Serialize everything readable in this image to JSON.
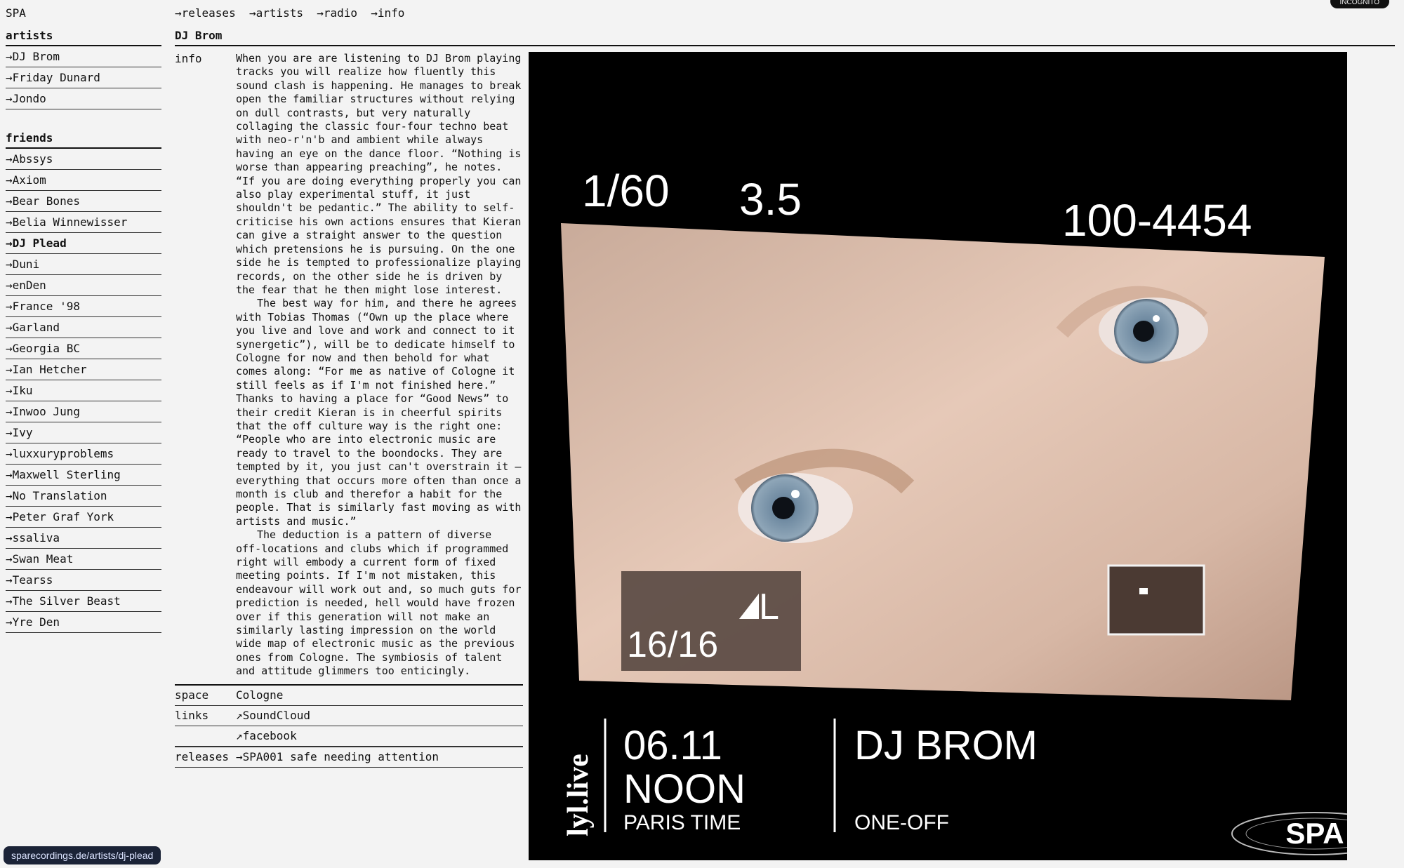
{
  "site": {
    "logo": "SPA"
  },
  "topnav": [
    "→releases",
    "→artists",
    "→radio",
    "→info"
  ],
  "incognito_label": "INCOGNITO",
  "sidebar": {
    "artists_heading": "artists",
    "artists": [
      "→DJ Brom",
      "→Friday Dunard",
      "→Jondo"
    ],
    "friends_heading": "friends",
    "friends": [
      "→Abssys",
      "→Axiom",
      "→Bear Bones",
      "→Belia Winnewisser",
      "→DJ Plead",
      "→Duni",
      "→enDen",
      "→France '98",
      "→Garland",
      "→Georgia BC",
      "→Ian Hetcher",
      "→Iku",
      "→Inwoo Jung",
      "→Ivy",
      "→luxxuryproblems",
      "→Maxwell Sterling",
      "→No Translation",
      "→Peter Graf York",
      "→ssaliva",
      "→Swan Meat",
      "→Tearss",
      "→The Silver Beast",
      "→Yre Den"
    ],
    "friends_bold_index": 4
  },
  "artist": {
    "name": "DJ Brom",
    "info_label": "info",
    "info_paragraphs": [
      "When you are are listening to DJ Brom playing tracks you will realize how fluently this sound clash is happening. He manages to break open the familiar structures without relying on dull contrasts, but very naturally collaging the classic four-four techno beat with neo-r'n'b and ambient while always having an eye on the dance floor. “Nothing is worse than appearing preaching”, he notes. “If you are doing everything properly you can also play experimental stuff, it just shouldn't be pedantic.” The ability to self-criticise his own actions ensures that Kieran can give a straight answer to the question which pretensions he is pursuing. On the one side he is tempted to professionalize playing records, on the other side he is driven by the fear that he then might lose interest.",
      "The best way for him, and there he agrees with Tobias Thomas (“Own up the place where you live and love and work and connect to it synergetic”), will be to dedicate himself to Cologne for now and then behold for what comes along: “For me as native of Cologne it still feels as if I'm not finished here.” Thanks to having a place for “Good News” to their credit Kieran is in cheerful spirits that the off culture way is the right one: “People who are into electronic music are ready to travel to the boondocks. They are tempted by it, you just can't overstrain it – everything that occurs more often than once a month is club and therefor a habit for the people. That is similarly fast moving as with artists and music.”",
      "The deduction is a pattern of diverse off-locations and clubs which if programmed right will embody a current form of fixed meeting points. If I'm not mistaken, this endeavour will work out and, so much guts for prediction is needed, hell would have frozen over if this generation will not make an similarly lasting impression on the world wide map of electronic music as the previous ones from Cologne. The symbiosis of talent and attitude glimmers too enticingly."
    ],
    "space_label": "space",
    "space_value": "Cologne",
    "links_label": "links",
    "links": [
      "↗SoundCloud",
      "↗facebook"
    ],
    "releases_label": "releases",
    "releases": [
      "→SPA001 safe needing attention"
    ]
  },
  "photo": {
    "cam_shutter": "1/60",
    "cam_aperture": "3.5",
    "cam_counter": "100-4454",
    "cam_shots": "16/16",
    "cam_quality": "L",
    "vertical_brand": "lyl.live",
    "date": "06.11",
    "time": "NOON",
    "timezone": "PARIS TIME",
    "artist": "DJ BROM",
    "edition": "ONE-OFF",
    "stamp": "SPA"
  },
  "status_url": "sparecordings.de/artists/dj-plead"
}
